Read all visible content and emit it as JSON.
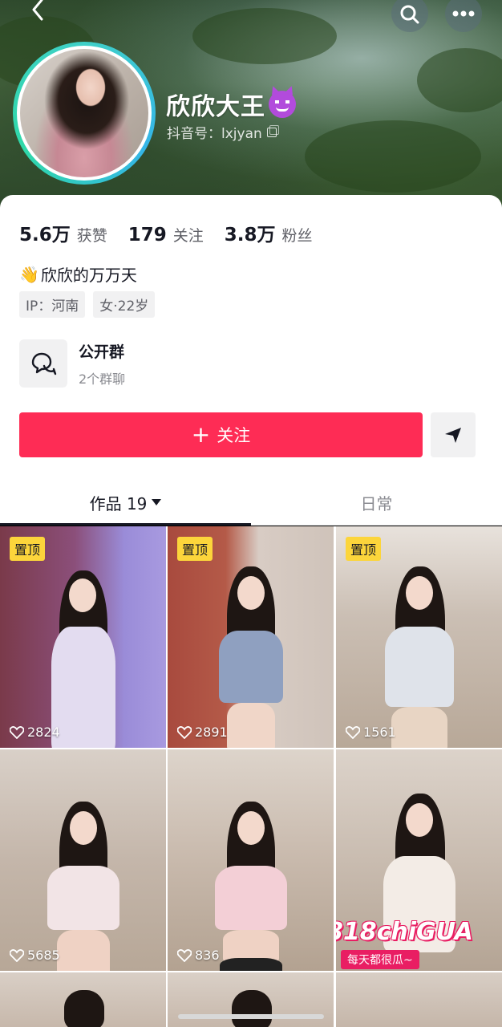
{
  "profile": {
    "nickname": "欣欣大王",
    "douyin_id": "抖音号：lxjyan",
    "bio": "欣欣的万万天",
    "tags": [
      "IP：河南",
      "女·22岁"
    ]
  },
  "stats": [
    {
      "num": "5.6万",
      "label": "获赞"
    },
    {
      "num": "179",
      "label": "关注"
    },
    {
      "num": "3.8万",
      "label": "粉丝"
    }
  ],
  "group": {
    "title": "公开群",
    "subtitle": "2个群聊"
  },
  "actions": {
    "follow_label": "关注"
  },
  "tabs": {
    "works": "作品 19",
    "daily": "日常"
  },
  "videos": [
    {
      "pinned": "置顶",
      "likes": "2824"
    },
    {
      "pinned": "置顶",
      "likes": "2891"
    },
    {
      "pinned": "置顶",
      "likes": "1561"
    },
    {
      "pinned": "",
      "likes": "5685"
    },
    {
      "pinned": "",
      "likes": "836"
    },
    {
      "pinned": "",
      "likes": ""
    }
  ],
  "promo": {
    "logo": "818chiGUA",
    "slogan": "每天都很瓜~"
  },
  "colors": {
    "accent": "#fe2c55",
    "pin": "#fcd53b"
  }
}
